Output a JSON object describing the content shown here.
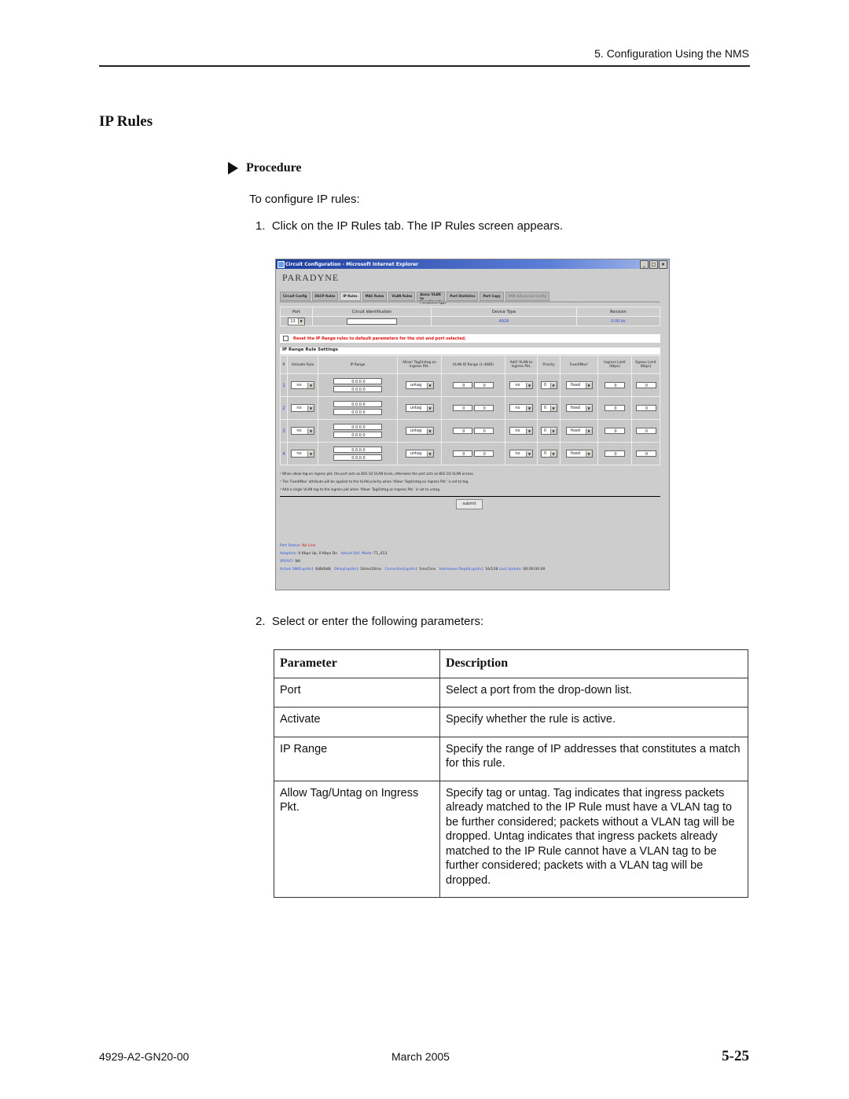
{
  "header": {
    "running_title": "5. Configuration Using the NMS"
  },
  "section": {
    "title": "IP Rules"
  },
  "procedure": {
    "heading": "Procedure",
    "intro": "To configure IP rules:",
    "step1": "1.  Click on the IP Rules tab. The IP Rules screen appears.",
    "step2": "2.  Select or enter the following parameters:"
  },
  "screenshot": {
    "window_title": "Circuit Configuration - Microsoft Internet Explorer",
    "window_buttons": [
      "_",
      "□",
      "×"
    ],
    "logo": "PARADYNE",
    "tabs": [
      "Circuit Config",
      "DSCP Rules",
      "IP Rules",
      "MAC Rules",
      "VLAN Rules",
      "Assoc VLAN to Port,EtherType",
      "Port Statistics",
      "Port Copy",
      "SNR Advanced Config"
    ],
    "active_tab": "IP Rules",
    "header_table": {
      "columns": [
        "Port",
        "Circuit Identification",
        "Device Type",
        "Revision"
      ],
      "port_value": "13",
      "circuit_id_value": "",
      "device_type": "4929",
      "revision": "0.00.kk"
    },
    "reset_label": "Reset the IP Range rules to default parameters for the slot and port selected.",
    "rules_title": "IP Range Rule Settings",
    "rules_columns": [
      "#",
      "Activate Rule",
      "IP Range",
      "Allow¹ Tag/Untag on Ingress Pkt.",
      "VLAN ID Range (1-4085)",
      "Add³ VLAN to Ingress Pkt.",
      "Priority",
      "Fixed/Max²",
      "Ingress Limit (Kbps)",
      "Egress Limit (Kbps)"
    ],
    "rules": [
      {
        "num": "1",
        "activate": "no",
        "ip_start": "0.0.0.0",
        "ip_end": "0.0.0.0",
        "allow": "untag",
        "vlan_from": "0",
        "vlan_to": "0",
        "add_vlan": "no",
        "priority": "0",
        "fixed_max": "fixed",
        "ingress": "0",
        "egress": "0"
      },
      {
        "num": "2",
        "activate": "no",
        "ip_start": "0.0.0.0",
        "ip_end": "0.0.0.0",
        "allow": "untag",
        "vlan_from": "0",
        "vlan_to": "0",
        "add_vlan": "no",
        "priority": "0",
        "fixed_max": "fixed",
        "ingress": "0",
        "egress": "0"
      },
      {
        "num": "3",
        "activate": "no",
        "ip_start": "0.0.0.0",
        "ip_end": "0.0.0.0",
        "allow": "untag",
        "vlan_from": "0",
        "vlan_to": "0",
        "add_vlan": "no",
        "priority": "0",
        "fixed_max": "fixed",
        "ingress": "0",
        "egress": "0"
      },
      {
        "num": "4",
        "activate": "no",
        "ip_start": "0.0.0.0",
        "ip_end": "0.0.0.0",
        "allow": "untag",
        "vlan_from": "0",
        "vlan_to": "0",
        "add_vlan": "no",
        "priority": "0",
        "fixed_max": "fixed",
        "ingress": "0",
        "egress": "0"
      }
    ],
    "notes": [
      "¹ When allow tag on ingress pkt, the port acts as 802.1Q VLAN trunk, otherwise the port acts as 802.1Q VLAN access.",
      "² The 'Fixed/Max' attribute will be applied to the VLAN priority when 'Allow¹ Tag/Untag on Ingress Pkt.' is set to tag.",
      "³ Add a single VLAN tag to the ingress pkt when 'Allow¹ Tag/Untag on Ingress Pkt.' is set to untag."
    ],
    "submit_label": "submit",
    "status": {
      "port_status_label": "Port Status:",
      "port_status_value": "No Link",
      "adaptive_label": "Adaptive:",
      "adaptive_value": "0 Kbps Up, 0 Kbps Dn",
      "std_mode_label": "Actual Std. Mode:",
      "std_mode_value": "T1_413",
      "vpivci_label": "VPI/VCI:",
      "vpivci_value": "NA",
      "snr_label": "Actual SNR[up/dn]:",
      "snr_value": "6dB/6dB",
      "delay_label": "Delay[up/dn]:",
      "delay_value": "16ms/16ms",
      "correction_label": "Correction[up/dn]:",
      "correction_value": "1ms/1ms",
      "interleave_label": "Interleave Depth[up/dn]:",
      "interleave_value": "16/128",
      "last_update_label": "Last Update:",
      "last_update_value": "00:00:00:00"
    }
  },
  "param_table": {
    "headers": [
      "Parameter",
      "Description"
    ],
    "rows": [
      {
        "param": "Port",
        "desc": "Select a port from the drop-down list."
      },
      {
        "param": "Activate",
        "desc": "Specify whether the rule is active."
      },
      {
        "param": "IP Range",
        "desc": "Specify the range of IP addresses that constitutes a match for this rule."
      },
      {
        "param": "Allow Tag/Untag on Ingress Pkt.",
        "desc": "Specify tag or untag. Tag indicates that ingress packets already matched to the IP Rule must have a VLAN tag to be further considered; packets without a VLAN tag will be dropped. Untag indicates that ingress packets already matched to the IP Rule cannot have a VLAN tag to be further considered; packets with a VLAN tag will be dropped."
      }
    ]
  },
  "footer": {
    "doc_number": "4929-A2-GN20-00",
    "date": "March 2005",
    "page": "5-25"
  }
}
